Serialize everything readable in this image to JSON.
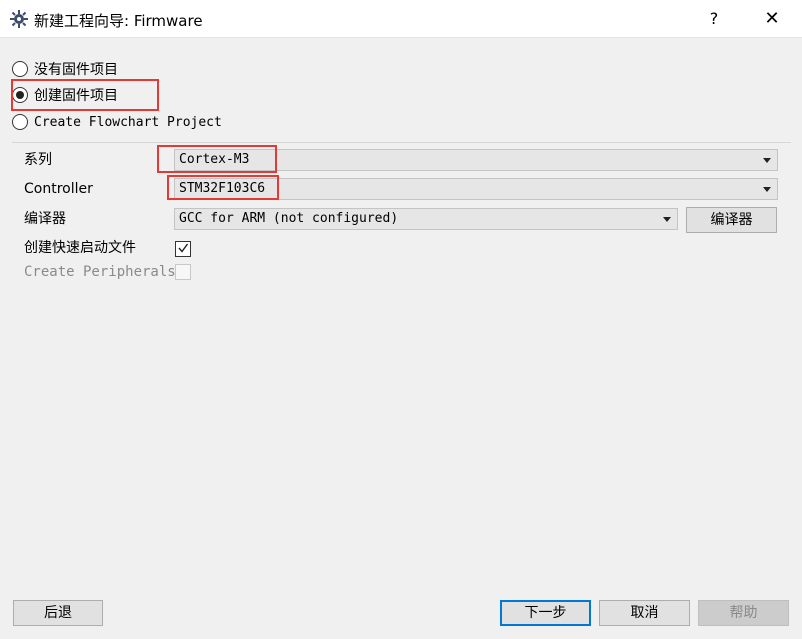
{
  "window": {
    "title": "新建工程向导: Firmware",
    "help_label": "?",
    "close_label": "✕"
  },
  "project_type": {
    "options": [
      {
        "label": "没有固件项目",
        "checked": false
      },
      {
        "label": "创建固件项目",
        "checked": true
      },
      {
        "label": "Create Flowchart Project",
        "checked": false
      }
    ]
  },
  "form": {
    "series_label": "系列",
    "series_value": "Cortex-M3",
    "controller_label": "Controller",
    "controller_value": "STM32F103C6",
    "compiler_label": "编译器",
    "compiler_value": "GCC for ARM (not configured)",
    "compiler_button": "编译器",
    "quick_start_label": "创建快速启动文件",
    "quick_start_checked": true,
    "peripherals_label": "Create Peripherals",
    "peripherals_checked": false
  },
  "footer": {
    "back": "后退",
    "next": "下一步",
    "cancel": "取消",
    "help": "帮助"
  },
  "colors": {
    "highlight": "#e53935",
    "primary_border": "#0078d7"
  }
}
